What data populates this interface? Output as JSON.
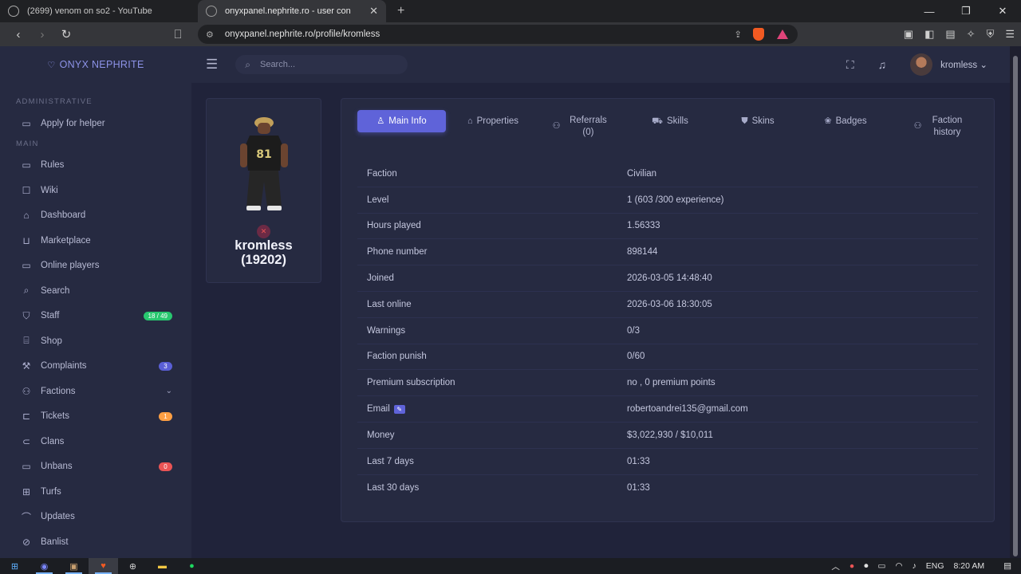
{
  "browser": {
    "tabs": [
      {
        "title": "(2699) venom on so2 - YouTube"
      },
      {
        "title": "onyxpanel.nephrite.ro - user con"
      }
    ],
    "url": "onyxpanel.nephrite.ro/profile/kromless"
  },
  "brand": {
    "name": "ONYX NEPHRITE"
  },
  "sidebar": {
    "section_admin": "ADMINISTRATIVE",
    "section_main": "MAIN",
    "admin_items": [
      {
        "label": "Apply for helper",
        "icon": "clipboard-icon"
      }
    ],
    "items": [
      {
        "label": "Rules",
        "icon": "book-icon"
      },
      {
        "label": "Wiki",
        "icon": "wiki-icon"
      },
      {
        "label": "Dashboard",
        "icon": "home-icon"
      },
      {
        "label": "Marketplace",
        "icon": "basket-icon"
      },
      {
        "label": "Online players",
        "icon": "players-icon"
      },
      {
        "label": "Search",
        "icon": "search-icon"
      },
      {
        "label": "Staff",
        "icon": "shield-icon",
        "badge": "18 / 49",
        "badge_color": "#28c76f"
      },
      {
        "label": "Shop",
        "icon": "shop-icon"
      },
      {
        "label": "Complaints",
        "icon": "gavel-icon",
        "badge": "3",
        "badge_color": "#5a5fd6"
      },
      {
        "label": "Factions",
        "icon": "users-icon"
      },
      {
        "label": "Tickets",
        "icon": "ticket-icon",
        "badge": "1",
        "badge_color": "#ff9f43"
      },
      {
        "label": "Clans",
        "icon": "clans-icon"
      },
      {
        "label": "Unbans",
        "icon": "unban-icon",
        "badge": "0",
        "badge_color": "#ea5455"
      },
      {
        "label": "Turfs",
        "icon": "map-icon"
      },
      {
        "label": "Updates",
        "icon": "updates-icon"
      },
      {
        "label": "Banlist",
        "icon": "banlist-icon"
      }
    ]
  },
  "topbar": {
    "search_placeholder": "Search...",
    "username": "kromless"
  },
  "profile": {
    "name": "kromless",
    "id_label": "(19202)"
  },
  "tabs": [
    {
      "label": "Main Info",
      "icon": "user-icon",
      "active": true
    },
    {
      "label": "Properties",
      "icon": "bank-icon"
    },
    {
      "label": "Referrals (0)",
      "icon": "referrals-icon"
    },
    {
      "label": "Skills",
      "icon": "car-icon"
    },
    {
      "label": "Skins",
      "icon": "shirt-icon"
    },
    {
      "label": "Badges",
      "icon": "badge-icon"
    },
    {
      "label": "Faction history",
      "icon": "history-icon"
    }
  ],
  "info_rows": [
    {
      "key": "Faction",
      "value": "Civilian"
    },
    {
      "key": "Level",
      "value": "1 (603 /300 experience)"
    },
    {
      "key": "Hours played",
      "value": "1.56333"
    },
    {
      "key": "Phone number",
      "value": "898144"
    },
    {
      "key": "Joined",
      "value": "2026-03-05 14:48:40"
    },
    {
      "key": "Last online",
      "value": "2026-03-06 18:30:05"
    },
    {
      "key": "Warnings",
      "value": "0/3"
    },
    {
      "key": "Faction punish",
      "value": "0/60"
    },
    {
      "key": "Premium subscription",
      "value": "no , 0 premium points"
    },
    {
      "key": "Email",
      "value": "robertoandrei135@gmail.com",
      "editable": true
    },
    {
      "key": "Money",
      "value": "$3,022,930 / $10,011"
    },
    {
      "key": "Last 7 days",
      "value": "01:33"
    },
    {
      "key": "Last 30 days",
      "value": "01:33"
    }
  ],
  "taskbar": {
    "lang": "ENG",
    "time": "8:20 AM"
  },
  "colors": {
    "accent": "#5f63d9",
    "sidebar_bg": "#262a41",
    "content_bg": "#20233a"
  }
}
